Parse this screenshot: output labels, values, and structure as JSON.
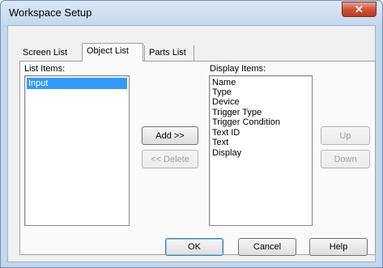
{
  "window": {
    "title": "Workspace Setup",
    "close_glyph": "✕"
  },
  "tabs": [
    {
      "label": "Screen List"
    },
    {
      "label": "Object List"
    },
    {
      "label": "Parts List"
    }
  ],
  "list_items": {
    "label": "List Items:",
    "items": [
      "Input"
    ]
  },
  "display_items": {
    "label": "Display Items:",
    "items": [
      "Name",
      "Type",
      "Device",
      "Trigger Type",
      "Trigger Condition",
      "Text ID",
      "Text",
      "Display"
    ]
  },
  "buttons": {
    "add": "Add >>",
    "delete": "<< Delete",
    "up": "Up",
    "down": "Down",
    "ok": "OK",
    "cancel": "Cancel",
    "help": "Help"
  },
  "colors": {
    "selection": "#3399ff",
    "close": "#c8462c"
  }
}
